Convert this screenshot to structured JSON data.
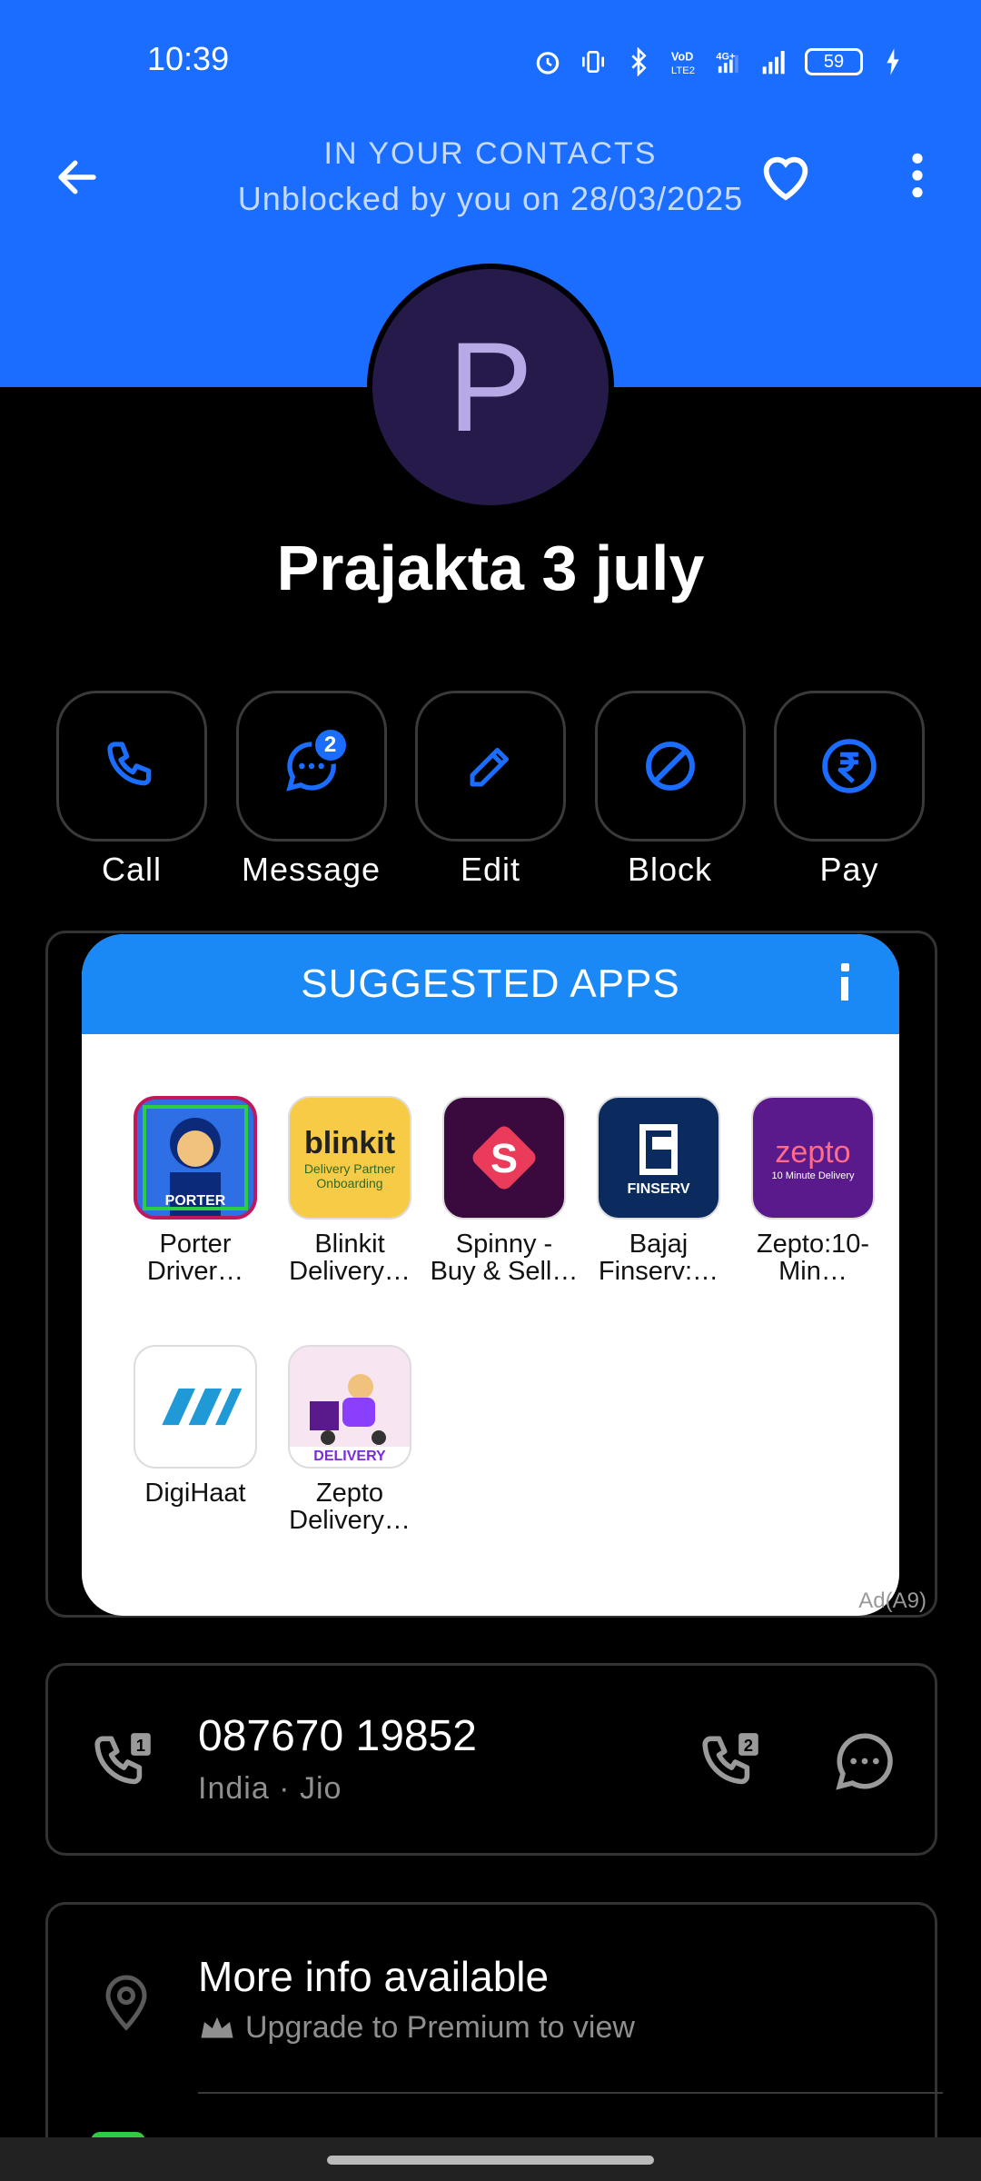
{
  "status": {
    "time": "10:39",
    "battery": "59",
    "network": "4G+"
  },
  "header": {
    "line1": "IN YOUR CONTACTS",
    "line2": "Unblocked by you on 28/03/2025",
    "bg_color": "#1A6DFF"
  },
  "contact": {
    "initial": "P",
    "name": "Prajakta 3 july"
  },
  "actions": [
    {
      "label": "Call",
      "icon": "phone-icon"
    },
    {
      "label": "Message",
      "icon": "message-icon",
      "badge": "2"
    },
    {
      "label": "Edit",
      "icon": "pencil-icon"
    },
    {
      "label": "Block",
      "icon": "block-icon"
    },
    {
      "label": "Pay",
      "icon": "rupee-icon"
    }
  ],
  "suggested_apps": {
    "title": "SUGGESTED APPS",
    "ad_label": "Ad(A9)",
    "apps": [
      {
        "line1": "Porter",
        "line2": "Driver…",
        "icon_text": "PORTER"
      },
      {
        "line1": "Blinkit",
        "line2": "Delivery…",
        "icon_text": "blinkit",
        "icon_sub": "Delivery Partner Onboarding"
      },
      {
        "line1": "Spinny -",
        "line2": "Buy & Sell…",
        "icon_text": "S"
      },
      {
        "line1": "Bajaj",
        "line2": "Finserv:…",
        "icon_text": "FINSERV"
      },
      {
        "line1": "Zepto:10-",
        "line2": "Min…",
        "icon_text": "zepto",
        "icon_sub": "10 Minute Delivery"
      },
      {
        "line1": "DigiHaat",
        "line2": "",
        "icon_text": ""
      },
      {
        "line1": "Zepto",
        "line2": "Delivery…",
        "icon_text": "DELIVERY"
      }
    ]
  },
  "phone": {
    "number": "087670 19852",
    "sub": "India · Jio",
    "sim1": "1",
    "sim2": "2"
  },
  "more_info": {
    "title": "More info available",
    "sub": "Upgrade to Premium to view"
  }
}
